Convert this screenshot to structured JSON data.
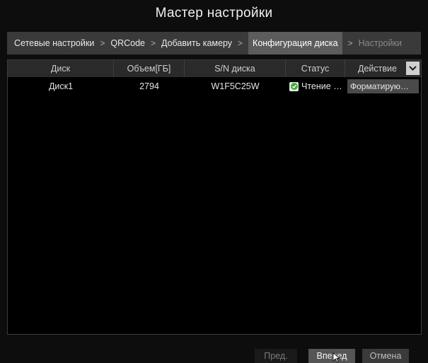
{
  "window": {
    "title": "Мастер настройки"
  },
  "steps": [
    {
      "label": "Сетевые настройки",
      "state": "done"
    },
    {
      "label": "QRCode",
      "state": "done"
    },
    {
      "label": "Добавить камеру",
      "state": "done"
    },
    {
      "label": "Конфигурация диска",
      "state": "active"
    },
    {
      "label": "Настройки",
      "state": "disabled"
    }
  ],
  "step_separator": ">",
  "table": {
    "columns": [
      "Диск",
      "Объем[ГБ]",
      "S/N диска",
      "Статус",
      "Действие"
    ],
    "rows": [
      {
        "disk": "Диск1",
        "capacity": "2794",
        "serial": "W1F5C25W",
        "status": "Чтение и…",
        "status_icon": "ok-check-icon",
        "action": "Форматирую…"
      }
    ]
  },
  "buttons": {
    "prev": "Пред.",
    "next": "Вперед",
    "cancel": "Отмена"
  },
  "colors": {
    "status_ok": "#36b336",
    "active_step": "#5c5c5c",
    "header": "#2a2a2a"
  }
}
